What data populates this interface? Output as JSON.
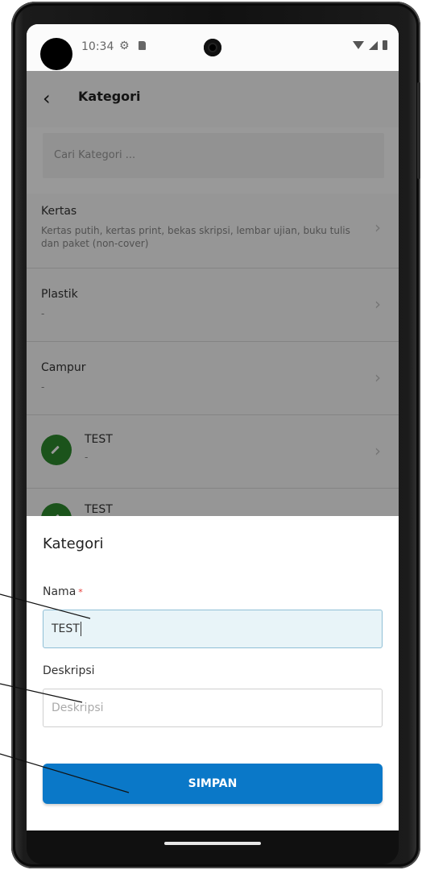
{
  "status_bar": {
    "time": "10:34",
    "icons": [
      "settings-icon",
      "sd-card-icon",
      "wifi-icon",
      "signal-icon",
      "battery-icon"
    ]
  },
  "app_bar": {
    "title": "Kategori",
    "back_icon": "chevron-left-icon"
  },
  "search": {
    "placeholder": "Cari Kategori ..."
  },
  "list": [
    {
      "title": "Kertas",
      "description": "Kertas putih, kertas print, bekas skripsi, lembar ujian, buku tulis dan paket (non-cover)"
    },
    {
      "title": "Plastik",
      "description": "-"
    },
    {
      "title": "Campur",
      "description": "-"
    },
    {
      "title": "TEST",
      "description": "-",
      "avatar_icon": "edit-pencil-icon"
    },
    {
      "title": "TEST",
      "avatar_icon": "edit-pencil-icon"
    }
  ],
  "sheet": {
    "title": "Kategori",
    "name_label": "Nama",
    "required_mark": "*",
    "name_value": "TEST",
    "description_label": "Deskripsi",
    "description_placeholder": "Deskripsi",
    "save_label": "SIMPAN"
  },
  "colors": {
    "primary": "#0a78c8",
    "avatar_green": "#2e8b2e",
    "required_red": "#e53935",
    "active_input_bg": "#e8f4f8"
  }
}
